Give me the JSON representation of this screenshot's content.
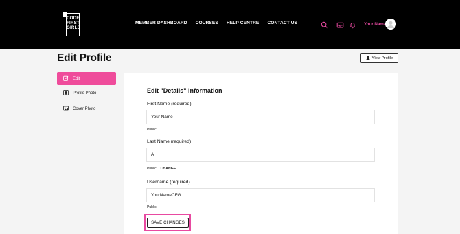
{
  "brand": {
    "logo_text": [
      "CODE",
      "FIRST",
      "GIRLS"
    ]
  },
  "nav": {
    "items": [
      {
        "label": "MEMBER DASHBOARD"
      },
      {
        "label": "COURSES"
      },
      {
        "label": "HELP CENTRE"
      },
      {
        "label": "CONTACT US"
      }
    ]
  },
  "header": {
    "icons": [
      "search-icon",
      "inbox-icon",
      "bell-icon"
    ],
    "accent_color": "#e84aa1",
    "user_name": "Your Name"
  },
  "page": {
    "title": "Edit Profile",
    "view_profile_label": "View Profile"
  },
  "sidebar": {
    "active_color": "#ef4c9b",
    "items": [
      {
        "label": "Edit",
        "icon": "edit-icon",
        "active": true
      },
      {
        "label": "Profile Photo",
        "icon": "profile-photo-icon",
        "active": false
      },
      {
        "label": "Cover Photo",
        "icon": "cover-photo-icon",
        "active": false
      }
    ]
  },
  "form": {
    "title": "Edit \"Details\" Information",
    "fields": [
      {
        "label": "First Name (required)",
        "value": "Your Name",
        "visibility": "Public",
        "action": ""
      },
      {
        "label": "Last Name (required)",
        "value": "A",
        "visibility": "Public",
        "action": "CHANGE"
      },
      {
        "label": "Username (required)",
        "value": "YourNameCFG",
        "visibility": "Public",
        "action": ""
      }
    ],
    "save_label": "SAVE CHANGES"
  }
}
